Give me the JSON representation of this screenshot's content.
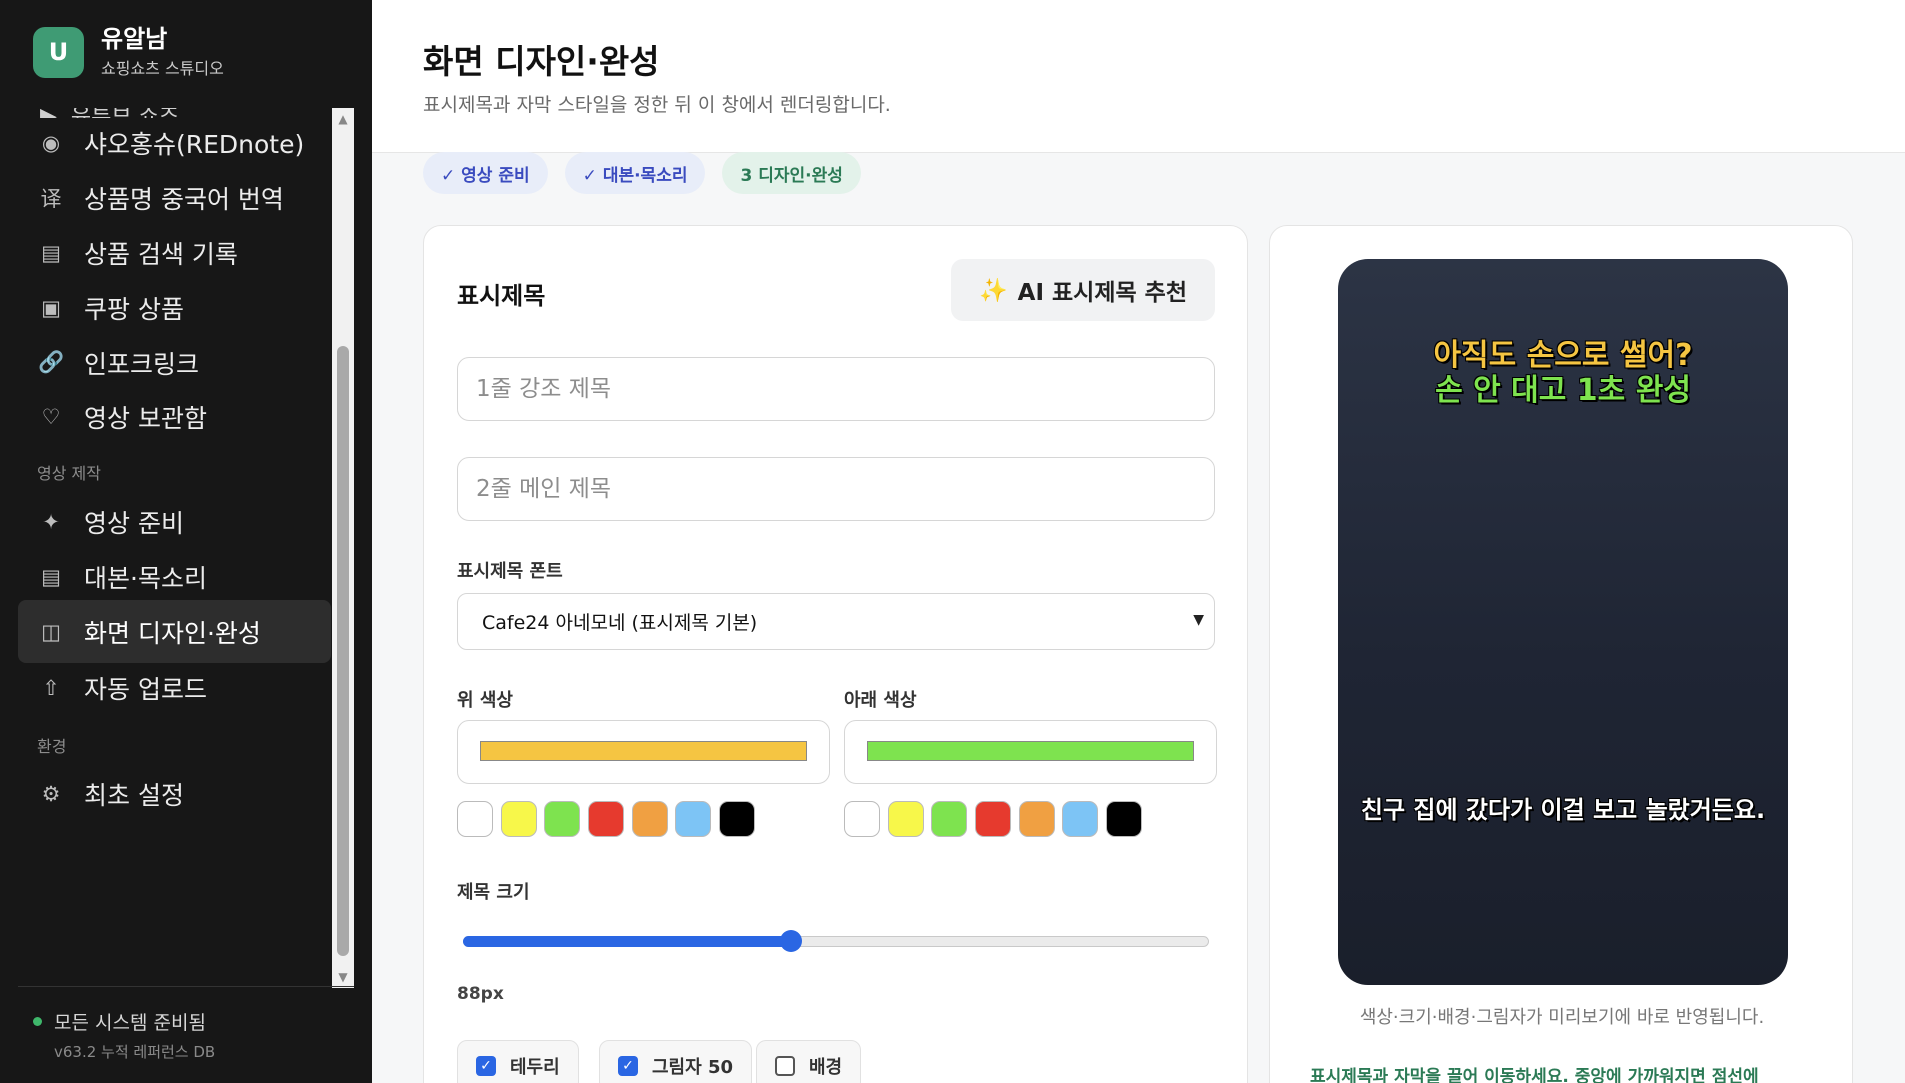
{
  "brand": {
    "logo_letter": "U",
    "name": "유알남",
    "subtitle": "쇼핑쇼츠 스튜디오"
  },
  "sidebar": {
    "partial_item": "유튜브 쇼츠",
    "items_top": [
      {
        "icon": "record-icon",
        "glyph": "◉",
        "label": "샤오홍슈(REDnote)"
      },
      {
        "icon": "translate-icon",
        "glyph": "译",
        "label": "상품명 중국어 번역"
      },
      {
        "icon": "list-icon",
        "glyph": "▤",
        "label": "상품 검색 기록"
      },
      {
        "icon": "box-icon",
        "glyph": "▣",
        "label": "쿠팡 상품"
      },
      {
        "icon": "link-icon",
        "glyph": "🔗",
        "label": "인포크링크"
      },
      {
        "icon": "heart-icon",
        "glyph": "♡",
        "label": "영상 보관함"
      }
    ],
    "section_production": "영상 제작",
    "items_production": [
      {
        "icon": "sparkle-icon",
        "glyph": "✦",
        "label": "영상 준비"
      },
      {
        "icon": "script-icon",
        "glyph": "▤",
        "label": "대본·목소리"
      },
      {
        "icon": "layout-icon",
        "glyph": "◫",
        "label": "화면 디자인·완성"
      },
      {
        "icon": "upload-icon",
        "glyph": "⇧",
        "label": "자동 업로드"
      }
    ],
    "section_env": "환경",
    "items_env": [
      {
        "icon": "gear-icon",
        "glyph": "⚙",
        "label": "최초 설정"
      }
    ],
    "status": "모든 시스템 준비됨",
    "version": "v63.2 누적 레퍼런스 DB"
  },
  "header": {
    "title": "화면 디자인·완성",
    "subtitle": "표시제목과 자막 스타일을 정한 뒤 이 창에서 렌더링합니다."
  },
  "steps": [
    {
      "label": "✓ 영상 준비",
      "state": "done"
    },
    {
      "label": "✓ 대본·목소리",
      "state": "done"
    },
    {
      "label": "3 디자인·완성",
      "state": "current"
    }
  ],
  "editor": {
    "title": "표시제목",
    "ai_button": "AI 표시제목 추천",
    "line1_placeholder": "1줄 강조 제목",
    "line2_placeholder": "2줄 메인 제목",
    "font_label": "표시제목 폰트",
    "font_value": "Cafe24 아네모네 (표시제목 기본)",
    "top_color_label": "위 색상",
    "bottom_color_label": "아래 색상",
    "top_color": "#f5c542",
    "bottom_color": "#7ee34f",
    "swatches": [
      "#ffffff",
      "#f7f74a",
      "#7ee34f",
      "#e63a2e",
      "#f0a042",
      "#7dc4f5",
      "#000000"
    ],
    "size_label": "제목 크기",
    "size_value": "88px",
    "size_fraction": 0.44,
    "toggles": [
      {
        "label": "테두리",
        "checked": true
      },
      {
        "label": "그림자 50",
        "checked": true
      },
      {
        "label": "배경",
        "checked": false
      }
    ]
  },
  "preview": {
    "headline_1": "아직도 손으로 썰어?",
    "headline_2": "손 안 대고 1초 완성",
    "caption": "친구 집에 갔다가 이걸 보고 놀랐거든요.",
    "note": "색상·크기·배경·그림자가 미리보기에 바로 반영됩니다.",
    "drag_note": "표시제목과 자막을 끌어 이동하세요. 중앙에 가까워지면 점선에"
  }
}
